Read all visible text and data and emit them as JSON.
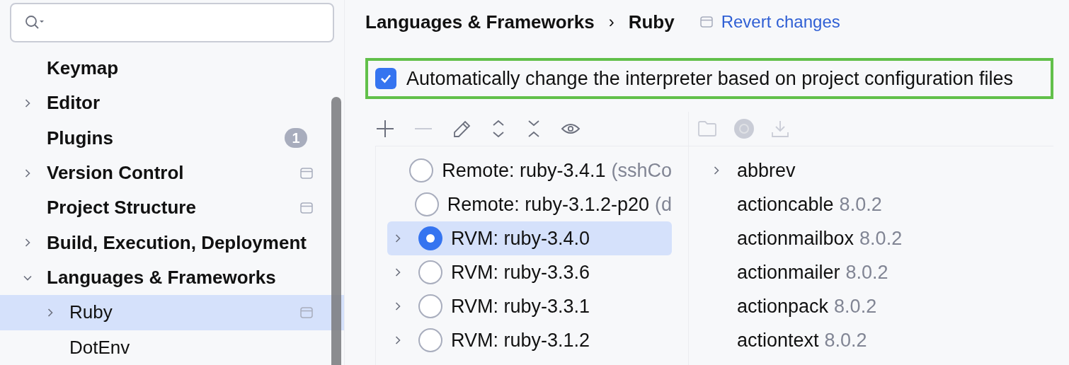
{
  "sidebar": {
    "items": [
      {
        "label": "Keymap",
        "selected": false
      },
      {
        "label": "Editor",
        "expanded": false,
        "selected": false
      },
      {
        "label": "Plugins",
        "badge": "1",
        "selected": false
      },
      {
        "label": "Version Control",
        "expanded": false,
        "project_icon": true,
        "selected": false
      },
      {
        "label": "Project Structure",
        "project_icon": true,
        "selected": false
      },
      {
        "label": "Build, Execution, Deployment",
        "expanded": false,
        "selected": false
      },
      {
        "label": "Languages & Frameworks",
        "expanded": true,
        "selected": false,
        "children": [
          {
            "label": "Ruby",
            "expanded": false,
            "project_icon": true,
            "selected": true
          },
          {
            "label": "DotEnv",
            "selected": false
          }
        ]
      }
    ]
  },
  "breadcrumb": {
    "parent": "Languages & Frameworks",
    "separator": "›",
    "current": "Ruby",
    "revert": "Revert changes"
  },
  "auto_interpreter": {
    "label": "Automatically change the interpreter based on project configuration files",
    "checked": true
  },
  "interpreters": [
    {
      "name": "Remote: ruby-3.4.1",
      "detail": "(sshCo",
      "selected": false
    },
    {
      "name": "Remote: ruby-3.1.2-p20",
      "detail": "(d",
      "selected": false
    },
    {
      "name": "RVM: ruby-3.4.0",
      "expanded": false,
      "selected": true
    },
    {
      "name": "RVM: ruby-3.3.6",
      "expanded": false,
      "selected": false
    },
    {
      "name": "RVM: ruby-3.3.1",
      "expanded": false,
      "selected": false
    },
    {
      "name": "RVM: ruby-3.1.2",
      "expanded": false,
      "selected": false
    }
  ],
  "gems": [
    {
      "name": "abbrev",
      "expanded": false
    },
    {
      "name": "actioncable",
      "version": "8.0.2"
    },
    {
      "name": "actionmailbox",
      "version": "8.0.2"
    },
    {
      "name": "actionmailer",
      "version": "8.0.2"
    },
    {
      "name": "actionpack",
      "version": "8.0.2"
    },
    {
      "name": "actiontext",
      "version": "8.0.2"
    }
  ]
}
